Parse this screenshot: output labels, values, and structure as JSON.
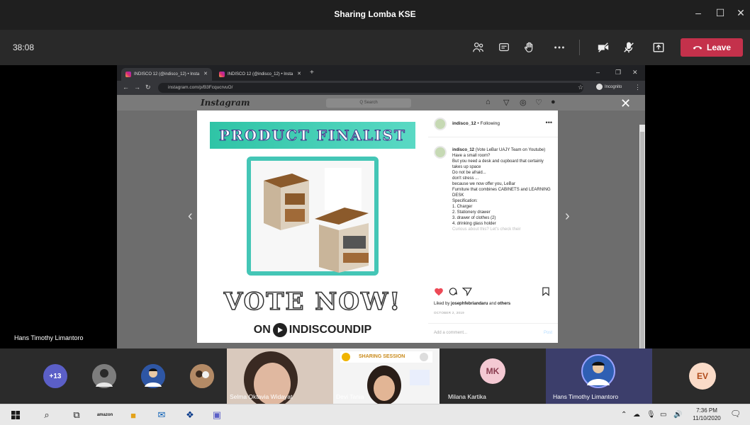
{
  "window": {
    "title": "Sharing Lomba KSE",
    "minimize": "–",
    "maximize": "☐",
    "close": "✕"
  },
  "meeting": {
    "timer": "38:08",
    "leave_label": "Leave"
  },
  "browser": {
    "tabs": [
      {
        "label": "INDISCO 12 (@indisco_12) • Insta"
      },
      {
        "label": "INDISCO 12 (@indisco_12) • Insta"
      }
    ],
    "url": "instagram.com/p/B3FcqucrvuO/",
    "incognito_label": "Incognito"
  },
  "instagram": {
    "logo": "Instagram",
    "search_placeholder": "Q Search",
    "post": {
      "banner": "PRODUCT FINALIST",
      "vote_text": "VOTE NOW!",
      "channel_prefix": "ON",
      "channel_name": "INDISCOUNDIP"
    },
    "header_handle": "indisco_12",
    "following": "• Following",
    "caption_lines": [
      "(Vote LeBar UAJY Team on Youtube)",
      "Have a small room?",
      "But you need a desk and cupboard that certainly takes up space",
      "",
      "Do not be afraid...",
      "don't stress ...",
      "because we now offer you, LeBar",
      "",
      "Furniture that combines CABINETS and LEARNING DESK",
      "",
      "Specification:",
      "1. Charger",
      "2. Stationery drawer",
      "3. drawer of clothes (2)",
      "4. drinking glass holder",
      "",
      "Curious about this? Let's check their"
    ],
    "likes_prefix": "Liked by",
    "liked_by": "josephfebriandaru",
    "likes_and": "and",
    "likes_others": "others",
    "date": "OCTOBER 2, 2019",
    "comment_placeholder": "Add a comment...",
    "post_button": "Post"
  },
  "presenter_name": "Hans Timothy Limantoro",
  "participants": {
    "overflow_count": "+13",
    "tiles": [
      {
        "name": "Selma Oktavia Widayat"
      },
      {
        "name": "Devi Tania"
      },
      {
        "name": "Milana Kartika",
        "initials": "MK"
      },
      {
        "name": "Hans Timothy Limantoro"
      },
      {
        "initials": "EV"
      }
    ],
    "tile_banner": "SHARING SESSION"
  },
  "taskbar": {
    "time": "7:36 PM",
    "date": "11/10/2020",
    "amazon_label": "amazon"
  },
  "colors": {
    "leave": "#c4314b",
    "teal": "#44c6b6",
    "heart": "#ed4956"
  }
}
